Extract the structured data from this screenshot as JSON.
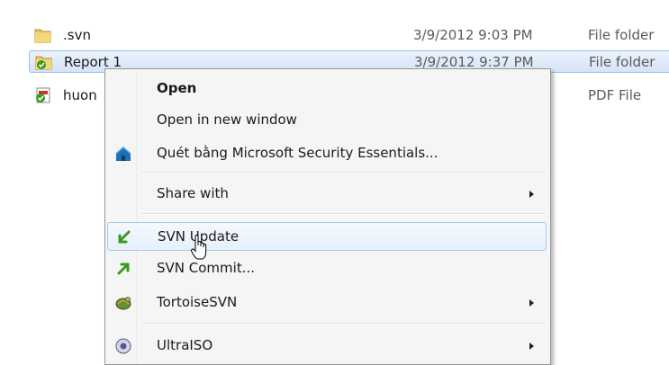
{
  "files": [
    {
      "name": ".svn",
      "date": "3/9/2012 9:03 PM",
      "type": "File folder",
      "icon": "folder-icon",
      "selected": false
    },
    {
      "name": "Report 1",
      "date": "3/9/2012 9:37 PM",
      "type": "File folder",
      "icon": "svn-folder-icon",
      "selected": true
    },
    {
      "name": "huon",
      "date": "",
      "type": "PDF File",
      "icon": "svn-pdf-icon",
      "selected": false
    }
  ],
  "context_menu": {
    "items": [
      {
        "label": "Open",
        "bold": true
      },
      {
        "label": "Open in new window"
      },
      {
        "label": "Quét bằng Microsoft Security Essentials...",
        "icon": "security-essentials-icon"
      },
      {
        "label": "Share with",
        "submenu": true
      },
      {
        "label": "SVN Update",
        "icon": "svn-update-icon",
        "hover": true
      },
      {
        "label": "SVN Commit...",
        "icon": "svn-commit-icon"
      },
      {
        "label": "TortoiseSVN",
        "icon": "tortoisesvn-icon",
        "submenu": true
      },
      {
        "label": "UltraISO",
        "icon": "ultraiso-icon",
        "submenu": true
      }
    ]
  },
  "colors": {
    "selection": "#d5e4f7",
    "menu_background": "#f5f5f5",
    "svn_green": "#3a9a1c"
  }
}
